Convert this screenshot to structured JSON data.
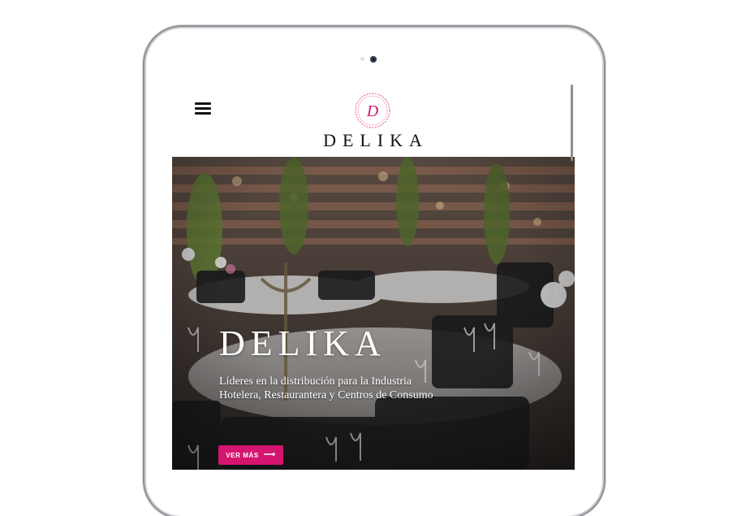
{
  "site": {
    "logo_letter": "D",
    "logo_text": "DELIKA"
  },
  "hero": {
    "title": "DELIKA",
    "subtitle": "Líderes en la distribución para la Industria Hotelera, Restaurantera y Centros de Consumo",
    "cta_label": "VER MÁS",
    "cta_icon": "arrow-right-icon"
  },
  "colors": {
    "accent": "#d4156f",
    "logo_ring": "#e66aa4"
  }
}
